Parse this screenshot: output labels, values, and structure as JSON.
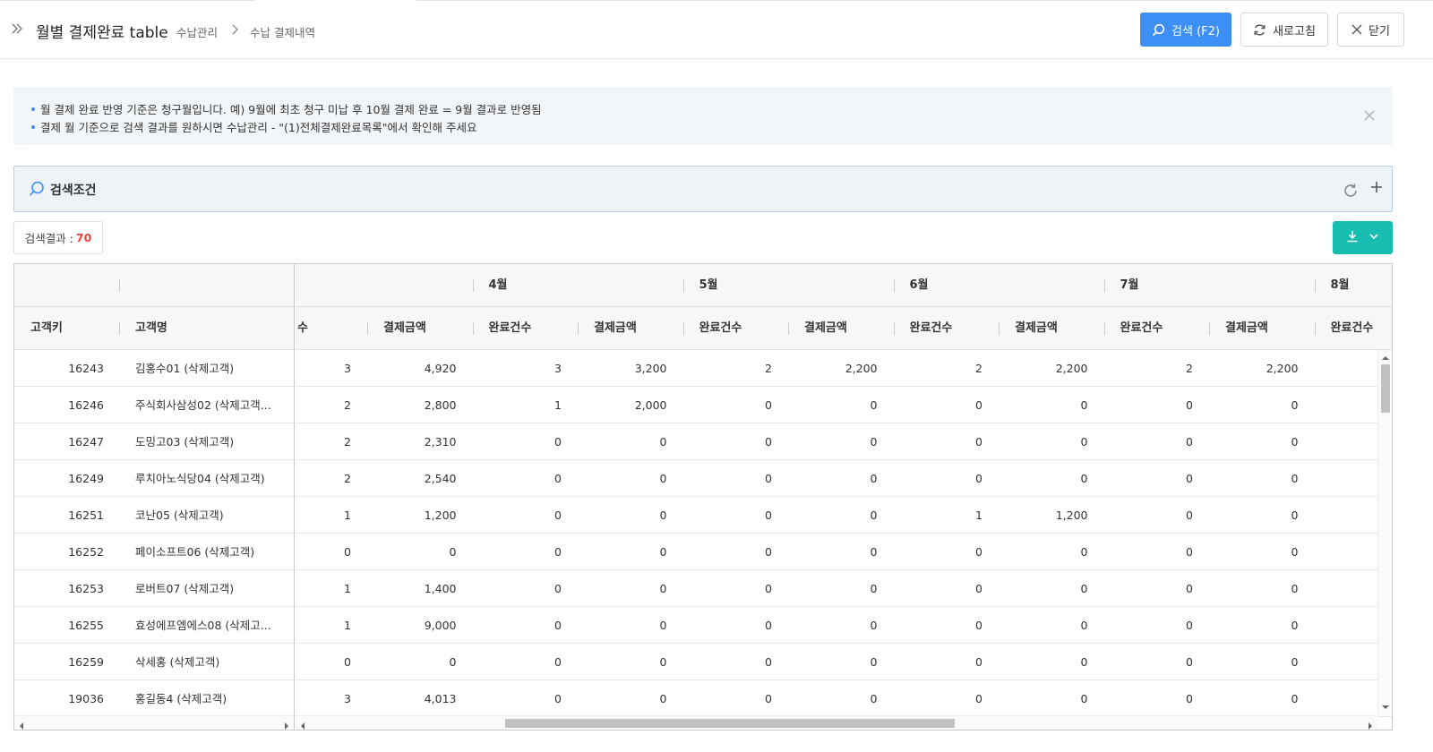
{
  "header": {
    "title": "월별 결제완료 table",
    "breadcrumb": [
      "수납관리",
      "수납 결제내역"
    ],
    "search_label": "검색 (F2)",
    "refresh_label": "새로고침",
    "close_label": "닫기"
  },
  "notice": {
    "lines": [
      "월 결제 완료 반영 기준은 청구월입니다. 예) 9월에 최초 청구 미납 후 10월 결제 완료 = 9월 결과로 반영됨",
      "결제 월 기준으로 검색 결과를 원하시면 수납관리 - \"(1)전체결제완료목록\"에서 확인해 주세요"
    ]
  },
  "search_condition": {
    "label": "검색조건"
  },
  "result": {
    "label": "검색결과 :",
    "count": "70"
  },
  "colors": {
    "primary": "#3d8ff5",
    "teal": "#17bdb0",
    "count": "#e8453c"
  },
  "grid": {
    "frozen_headers": [
      "고객키",
      "고객명"
    ],
    "month_groups": [
      "4월",
      "5월",
      "6월",
      "7월",
      "8월"
    ],
    "sub_headers": [
      "수",
      "결제금액",
      "완료건수",
      "결제금액",
      "완료건수",
      "결제금액",
      "완료건수",
      "결제금액",
      "완료건수",
      "결제금액",
      "완료건수"
    ],
    "rows": [
      {
        "key": "16243",
        "name": "김홍수01 (삭제고객)",
        "vals": [
          "3",
          "4,920",
          "3",
          "3,200",
          "2",
          "2,200",
          "2",
          "2,200",
          "2",
          "2,200"
        ]
      },
      {
        "key": "16246",
        "name": "주식회사삼성02 (삭제고객...",
        "vals": [
          "2",
          "2,800",
          "1",
          "2,000",
          "0",
          "0",
          "0",
          "0",
          "0",
          "0"
        ]
      },
      {
        "key": "16247",
        "name": "도밍고03 (삭제고객)",
        "vals": [
          "2",
          "2,310",
          "0",
          "0",
          "0",
          "0",
          "0",
          "0",
          "0",
          "0"
        ]
      },
      {
        "key": "16249",
        "name": "루치아노식당04 (삭제고객)",
        "vals": [
          "2",
          "2,540",
          "0",
          "0",
          "0",
          "0",
          "0",
          "0",
          "0",
          "0"
        ]
      },
      {
        "key": "16251",
        "name": "코난05 (삭제고객)",
        "vals": [
          "1",
          "1,200",
          "0",
          "0",
          "0",
          "0",
          "1",
          "1,200",
          "0",
          "0"
        ]
      },
      {
        "key": "16252",
        "name": "페이소프트06 (삭제고객)",
        "vals": [
          "0",
          "0",
          "0",
          "0",
          "0",
          "0",
          "0",
          "0",
          "0",
          "0"
        ]
      },
      {
        "key": "16253",
        "name": "로버트07 (삭제고객)",
        "vals": [
          "1",
          "1,400",
          "0",
          "0",
          "0",
          "0",
          "0",
          "0",
          "0",
          "0"
        ]
      },
      {
        "key": "16255",
        "name": "효성에프엠에스08 (삭제고...",
        "vals": [
          "1",
          "9,000",
          "0",
          "0",
          "0",
          "0",
          "0",
          "0",
          "0",
          "0"
        ]
      },
      {
        "key": "16259",
        "name": "삭세홍 (삭제고객)",
        "vals": [
          "0",
          "0",
          "0",
          "0",
          "0",
          "0",
          "0",
          "0",
          "0",
          "0"
        ]
      },
      {
        "key": "19036",
        "name": "홍길동4 (삭제고객)",
        "vals": [
          "3",
          "4,013",
          "0",
          "0",
          "0",
          "0",
          "0",
          "0",
          "0",
          "0"
        ]
      }
    ]
  },
  "icons": {
    "expand": "double-chevron-right-icon",
    "search": "search-icon",
    "refresh": "refresh-icon",
    "close": "close-icon",
    "download": "download-icon",
    "dropdown": "chevron-down-icon"
  }
}
